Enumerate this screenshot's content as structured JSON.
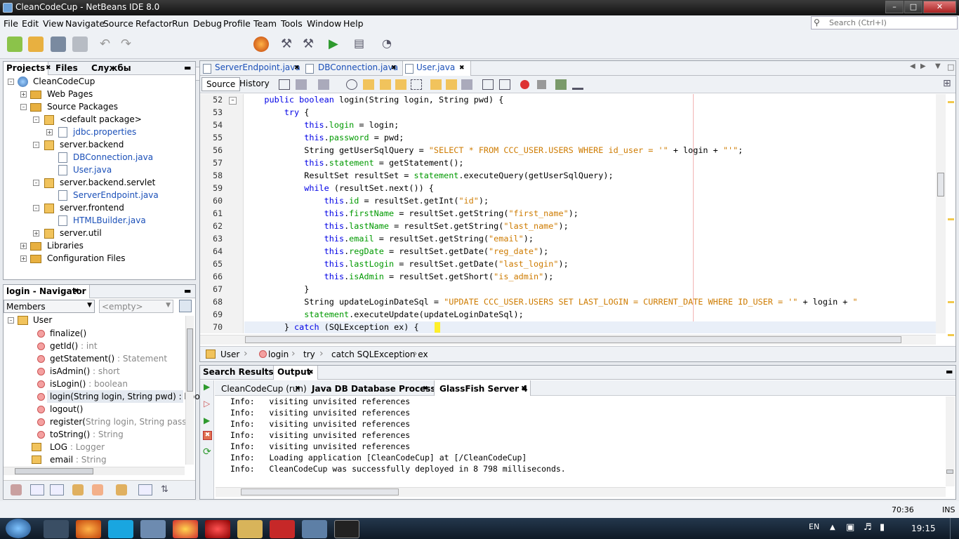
{
  "window": {
    "title": "CleanCodeCup - NetBeans IDE 8.0",
    "controls": [
      "minimize-icon",
      "maximize-icon",
      "close-icon"
    ]
  },
  "menu": [
    "File",
    "Edit",
    "View",
    "Navigate",
    "Source",
    "Refactor",
    "Run",
    "Debug",
    "Profile",
    "Team",
    "Tools",
    "Window",
    "Help"
  ],
  "search": {
    "placeholder": "Search (Ctrl+I)"
  },
  "projects_panel": {
    "tabs": [
      "Projects",
      "Files",
      "Службы"
    ],
    "tree": [
      {
        "label": "CleanCodeCup",
        "level": 0
      },
      {
        "label": "Web Pages",
        "level": 1
      },
      {
        "label": "Source Packages",
        "level": 1
      },
      {
        "label": "<default package>",
        "level": 2
      },
      {
        "label": "jdbc.properties",
        "level": 3
      },
      {
        "label": "server.backend",
        "level": 2
      },
      {
        "label": "DBConnection.java",
        "level": 3
      },
      {
        "label": "User.java",
        "level": 3
      },
      {
        "label": "server.backend.servlet",
        "level": 2
      },
      {
        "label": "ServerEndpoint.java",
        "level": 3
      },
      {
        "label": "server.frontend",
        "level": 2
      },
      {
        "label": "HTMLBuilder.java",
        "level": 3
      },
      {
        "label": "server.util",
        "level": 2
      },
      {
        "label": "Libraries",
        "level": 1
      },
      {
        "label": "Configuration Files",
        "level": 1
      }
    ]
  },
  "navigator": {
    "title": "login - Navigator",
    "filter": "Members",
    "scope": "<empty>",
    "root": "User",
    "members": [
      {
        "name": "finalize()",
        "type": ""
      },
      {
        "name": "getId()",
        "type": " : int"
      },
      {
        "name": "getStatement()",
        "type": " : Statement"
      },
      {
        "name": "isAdmin()",
        "type": " : short"
      },
      {
        "name": "isLogin()",
        "type": " : boolean"
      },
      {
        "name": "login(String login, String pwd) : boolean",
        "type": ""
      },
      {
        "name": "logout()",
        "type": ""
      },
      {
        "name": "register(",
        "type": "String login, String password, St"
      },
      {
        "name": "toString()",
        "type": " : String"
      },
      {
        "name": "LOG",
        "type": " : Logger"
      },
      {
        "name": "email",
        "type": " : String"
      }
    ]
  },
  "editor": {
    "tabs": [
      "ServerEndpoint.java",
      "DBConnection.java",
      "User.java"
    ],
    "active_tab": "User.java",
    "toolbar": {
      "source": "Source",
      "history": "History"
    },
    "lines": [
      {
        "n": "52",
        "html": "    <span class='kw'>public boolean</span> login(String login, String pwd) {"
      },
      {
        "n": "53",
        "html": "        <span class='kw'>try</span> {"
      },
      {
        "n": "54",
        "html": "            <span class='kw'>this</span>.<span class='fld'>login</span> = login;"
      },
      {
        "n": "55",
        "html": "            <span class='kw'>this</span>.<span class='fld'>password</span> = pwd;"
      },
      {
        "n": "56",
        "html": "            String getUserSqlQuery = <span class='str'>\"SELECT * FROM CCC_USER.USERS WHERE id_user = '\"</span> + login + <span class='str'>\"'\"</span>;"
      },
      {
        "n": "57",
        "html": "            <span class='kw'>this</span>.<span class='fld'>statement</span> = getStatement();"
      },
      {
        "n": "58",
        "html": "            ResultSet resultSet = <span class='fld'>statement</span>.executeQuery(getUserSqlQuery);"
      },
      {
        "n": "59",
        "html": "            <span class='kw'>while</span> (resultSet.next()) {"
      },
      {
        "n": "60",
        "html": "                <span class='kw'>this</span>.<span class='fld'>id</span> = resultSet.getInt(<span class='str'>\"id\"</span>);"
      },
      {
        "n": "61",
        "html": "                <span class='kw'>this</span>.<span class='fld'>firstName</span> = resultSet.getString(<span class='str'>\"first_name\"</span>);"
      },
      {
        "n": "62",
        "html": "                <span class='kw'>this</span>.<span class='fld'>lastName</span> = resultSet.getString(<span class='str'>\"last_name\"</span>);"
      },
      {
        "n": "63",
        "html": "                <span class='kw'>this</span>.<span class='fld'>email</span> = resultSet.getString(<span class='str'>\"email\"</span>);"
      },
      {
        "n": "64",
        "html": "                <span class='kw'>this</span>.<span class='fld'>regDate</span> = resultSet.getDate(<span class='str'>\"reg_date\"</span>);"
      },
      {
        "n": "65",
        "html": "                <span class='kw'>this</span>.<span class='fld'>lastLogin</span> = resultSet.getDate(<span class='str'>\"last_login\"</span>);"
      },
      {
        "n": "66",
        "html": "                <span class='kw'>this</span>.<span class='fld'>isAdmin</span> = resultSet.getShort(<span class='str'>\"is_admin\"</span>);"
      },
      {
        "n": "67",
        "html": "            }"
      },
      {
        "n": "68",
        "html": "            String updateLoginDateSql = <span class='str'>\"UPDATE CCC_USER.USERS SET LAST_LOGIN = CURRENT_DATE WHERE ID_USER = '\"</span> + login + <span class='str'>\"</span>"
      },
      {
        "n": "69",
        "html": "            <span class='fld'>statement</span>.executeUpdate(updateLoginDateSql);"
      },
      {
        "n": "70",
        "html": "        } <span class='kw'>catch</span> (SQLException ex) {"
      }
    ],
    "breadcrumb": [
      "User",
      "login",
      "try",
      "catch SQLException ex"
    ]
  },
  "output": {
    "tabs": [
      "Search Results",
      "Output"
    ],
    "subtabs": [
      "CleanCodeCup (run)",
      "Java DB Database Process",
      "GlassFish Server 4"
    ],
    "active_subtab": "GlassFish Server 4",
    "lines": [
      "Info:   visiting unvisited references",
      "Info:   visiting unvisited references",
      "Info:   visiting unvisited references",
      "Info:   visiting unvisited references",
      "Info:   visiting unvisited references",
      "Info:   Loading application [CleanCodeCup] at [/CleanCodeCup]",
      "Info:   CleanCodeCup was successfully deployed in 8 798 milliseconds."
    ]
  },
  "status": {
    "position": "70:36",
    "mode": "INS"
  },
  "taskbar": {
    "lang": "EN",
    "time": "19:15"
  }
}
